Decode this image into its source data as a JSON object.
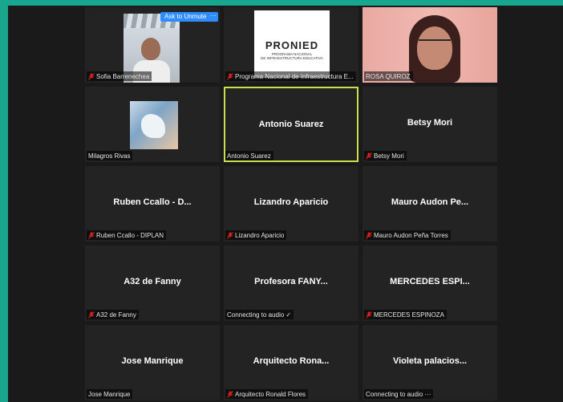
{
  "toolbar": {
    "ask_unmute": "Ask to Unmute",
    "more": "···"
  },
  "logo": {
    "main": "PRONIED",
    "sub_line1": "PROGRAMA NACIONAL",
    "sub_line2": "DE INFRAESTRUCTURA EDUCATIVA"
  },
  "tiles": [
    {
      "label": "Sofia Barrenechea",
      "muted": true
    },
    {
      "label": "Programa Nacional de Infraestructura E...",
      "muted": true
    },
    {
      "label": "ROSA QUIROZ",
      "muted": false
    },
    {
      "label": "Milagros Rivas",
      "muted": false
    },
    {
      "name": "Antonio Suarez",
      "label": "Antonio Suarez",
      "muted": false,
      "active": true
    },
    {
      "name": "Betsy Mori",
      "label": "Betsy Mori",
      "muted": true
    },
    {
      "name": "Ruben Ccallo - D...",
      "label": "Ruben Ccallo - DIPLAN",
      "muted": true
    },
    {
      "name": "Lizandro Aparicio",
      "label": "Lizandro Aparicio",
      "muted": true
    },
    {
      "name": "Mauro Audon Pe...",
      "label": "Mauro Audon Peña Torres",
      "muted": true
    },
    {
      "name": "A32 de Fanny",
      "label": "A32 de Fanny",
      "muted": true
    },
    {
      "name": "Profesora FANY...",
      "label": "Connecting to audio ✓",
      "muted": false
    },
    {
      "name": "MERCEDES ESPI...",
      "label": "MERCEDES ESPINOZA",
      "muted": true
    },
    {
      "name": "Jose Manrique",
      "label": "Jose Manrique",
      "muted": false
    },
    {
      "name": "Arquitecto Rona...",
      "label": "Arquitecto Ronald Flores",
      "muted": true
    },
    {
      "name": "Violeta palacios...",
      "label": "Connecting to audio ···",
      "muted": false
    }
  ]
}
